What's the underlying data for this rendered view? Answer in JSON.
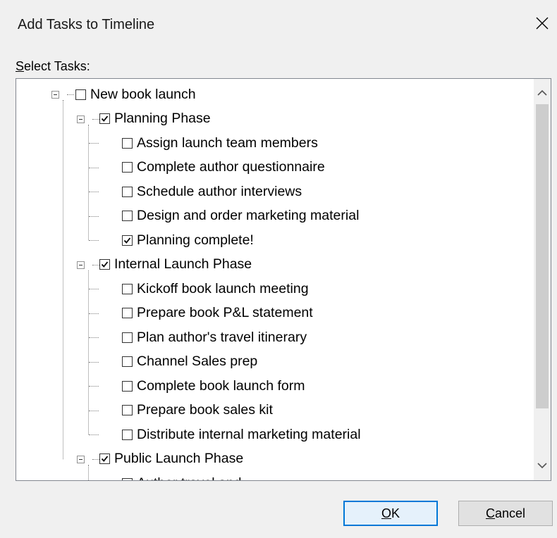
{
  "dialog": {
    "title": "Add Tasks to Timeline",
    "close_icon": "close-icon"
  },
  "select_label": {
    "accel": "S",
    "rest": "elect Tasks:"
  },
  "tree": [
    {
      "label": "New book launch",
      "level": 0,
      "checked": false,
      "expandable": true
    },
    {
      "label": "Planning Phase",
      "level": 1,
      "checked": true,
      "expandable": true
    },
    {
      "label": "Assign launch team members",
      "level": 2,
      "checked": false
    },
    {
      "label": "Complete author questionnaire",
      "level": 2,
      "checked": false
    },
    {
      "label": "Schedule author interviews",
      "level": 2,
      "checked": false
    },
    {
      "label": "Design and order marketing material",
      "level": 2,
      "checked": false
    },
    {
      "label": "Planning complete!",
      "level": 2,
      "checked": true
    },
    {
      "label": "Internal Launch Phase",
      "level": 1,
      "checked": true,
      "expandable": true
    },
    {
      "label": "Kickoff book launch meeting",
      "level": 2,
      "checked": false
    },
    {
      "label": "Prepare book P&L statement",
      "level": 2,
      "checked": false
    },
    {
      "label": "Plan author's travel itinerary",
      "level": 2,
      "checked": false
    },
    {
      "label": "Channel Sales prep",
      "level": 2,
      "checked": false
    },
    {
      "label": "Complete book launch form",
      "level": 2,
      "checked": false
    },
    {
      "label": "Prepare book sales kit",
      "level": 2,
      "checked": false
    },
    {
      "label": "Distribute internal marketing material",
      "level": 2,
      "checked": false
    },
    {
      "label": "Public Launch Phase",
      "level": 1,
      "checked": true,
      "expandable": true
    },
    {
      "label": "Author travel and",
      "level": 2,
      "checked": false
    }
  ],
  "buttons": {
    "ok": {
      "accel": "O",
      "rest": "K"
    },
    "cancel": {
      "accel": "C",
      "rest": "ancel"
    }
  }
}
